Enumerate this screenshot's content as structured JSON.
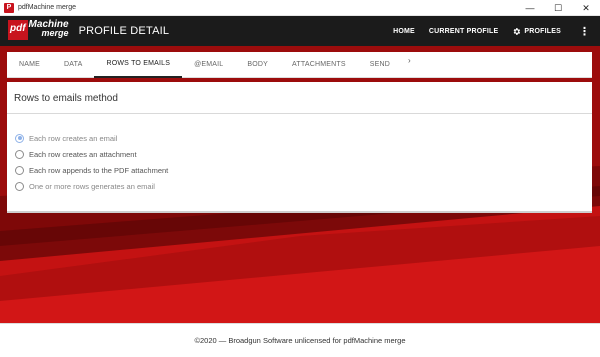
{
  "window": {
    "title": "pdfMachine merge",
    "app_icon_glyph": "P",
    "minimize_glyph": "—",
    "maximize_glyph": "☐",
    "close_glyph": "✕"
  },
  "header": {
    "logo": {
      "pdf": "pdf",
      "machine": "Machine",
      "merge": "merge"
    },
    "page_title": "PROFILE DETAIL",
    "nav": {
      "home": "HOME",
      "current_profile": "CURRENT PROFILE",
      "profiles": "PROFILES",
      "more_glyph": "⋮"
    }
  },
  "tabs": {
    "items": [
      {
        "label": "NAME"
      },
      {
        "label": "DATA"
      },
      {
        "label": "ROWS TO EMAILS"
      },
      {
        "label": "@EMAIL"
      },
      {
        "label": "BODY"
      },
      {
        "label": "ATTACHMENTS"
      },
      {
        "label": "SEND"
      }
    ],
    "active": "ROWS TO EMAILS",
    "next_glyph": "›"
  },
  "card": {
    "title": "Rows to emails method",
    "options": [
      {
        "label": "Each row creates an email",
        "selected": true
      },
      {
        "label": "Each row creates an attachment",
        "selected": false
      },
      {
        "label": "Each row appends to the PDF attachment",
        "selected": false
      },
      {
        "label": "One or more rows generates an email",
        "selected": false
      }
    ]
  },
  "footer": {
    "text": "©2020 — Broadgun Software   unlicensed for pdfMachine merge"
  },
  "colors": {
    "brand_red": "#c8141e",
    "header_bg": "#1b1b1b",
    "background_red": "#a30d0d",
    "radio_selected": "#8fb2e8"
  }
}
